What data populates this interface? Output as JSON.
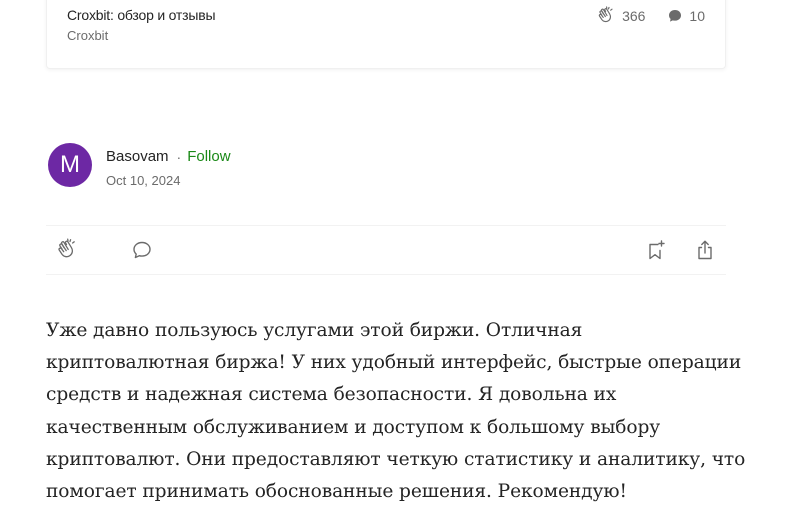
{
  "related_card": {
    "title": "Croxbit: обзор и отзывы",
    "publication": "Croxbit",
    "claps": "366",
    "responses": "10",
    "clap_icon": "clap-icon",
    "response_icon": "speech-bubble-icon"
  },
  "author": {
    "initial": "M",
    "name": "Basovam",
    "separator": "·",
    "follow_label": "Follow",
    "date": "Oct 10, 2024",
    "avatar_color": "#6d28a4"
  },
  "actions": {
    "clap_icon": "clap-icon",
    "response_icon": "response-icon",
    "bookmark_icon": "bookmark-add-icon",
    "share_icon": "share-icon"
  },
  "response_text": "Уже давно пользуюсь услугами этой биржи. Отличная криптовалютная биржа! У них удобный интерфейс, быстрые операции средств и надежная система безопасности. Я довольна их качественным обслуживанием и доступом к большому выбору криптовалют. Они предоставляют четкую статистику и аналитику, что помогает принимать обоснованные решения. Рекомендую!",
  "colors": {
    "follow": "#1a8917",
    "text": "#242424",
    "muted": "#6b6b6b"
  }
}
